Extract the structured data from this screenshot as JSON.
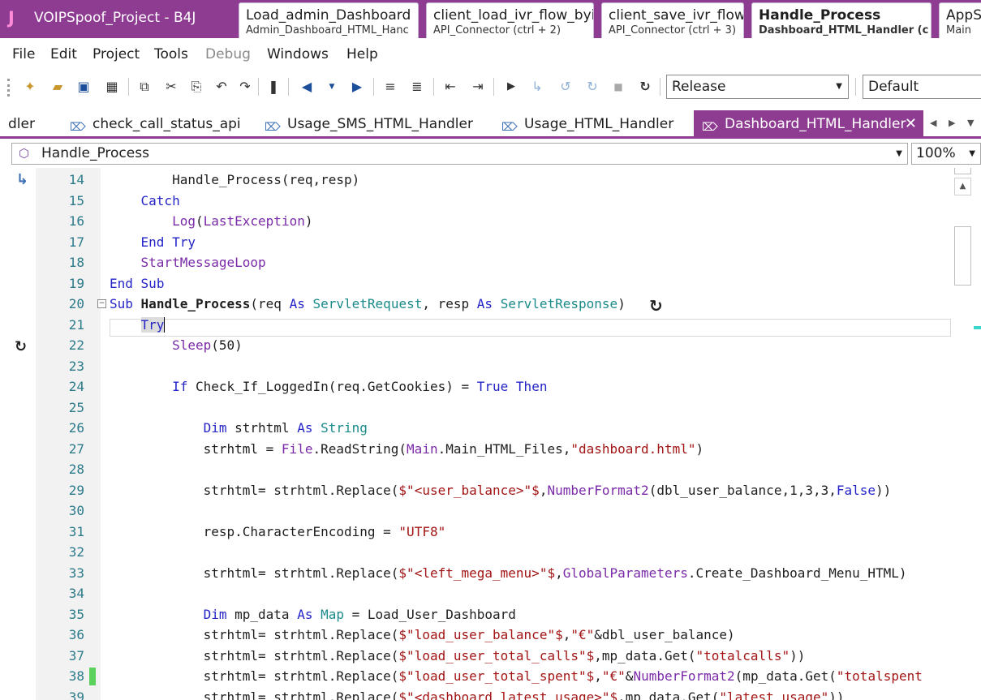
{
  "window": {
    "app_letter": "J",
    "title": "VOIPSpoof_Project - B4J"
  },
  "top_tabs": [
    {
      "title": "Load_admin_Dashboard",
      "sub": "Admin_Dashboard_HTML_Hanc"
    },
    {
      "title": "client_load_ivr_flow_byid",
      "sub": "API_Connector  (ctrl + 2)"
    },
    {
      "title": "client_save_ivr_flow",
      "sub": "API_Connector  (ctrl + 3)"
    },
    {
      "title": "Handle_Process",
      "sub": "Dashboard_HTML_Handler  (c"
    },
    {
      "title": "AppS",
      "sub": "Main"
    }
  ],
  "menu": [
    "File",
    "Edit",
    "Project",
    "Tools",
    "Debug",
    "Windows",
    "Help"
  ],
  "toolbar": {
    "build_config": "Release",
    "platform": "Default"
  },
  "doc_tabs": [
    {
      "label": "dler"
    },
    {
      "label": "check_call_status_api"
    },
    {
      "label": "Usage_SMS_HTML_Handler"
    },
    {
      "label": "Usage_HTML_Handler"
    },
    {
      "label": "Dashboard_HTML_Handler"
    }
  ],
  "nav": {
    "member": "Handle_Process",
    "zoom": "100%"
  },
  "code_lines": [
    {
      "n": "14",
      "text": "        Handle_Process(req,resp)"
    },
    {
      "n": "15",
      "text": "    Catch"
    },
    {
      "n": "16",
      "text": "        Log(LastException)"
    },
    {
      "n": "17",
      "text": "    End Try"
    },
    {
      "n": "18",
      "text": "    StartMessageLoop"
    },
    {
      "n": "19",
      "text": "End Sub"
    },
    {
      "n": "20",
      "text": "Sub Handle_Process(req As ServletRequest, resp As ServletResponse)"
    },
    {
      "n": "21",
      "text": "    Try"
    },
    {
      "n": "22",
      "text": "        Sleep(50)"
    },
    {
      "n": "23",
      "text": ""
    },
    {
      "n": "24",
      "text": "        If Check_If_LoggedIn(req.GetCookies) = True Then"
    },
    {
      "n": "25",
      "text": ""
    },
    {
      "n": "26",
      "text": "            Dim strhtml As String"
    },
    {
      "n": "27",
      "text": "            strhtml = File.ReadString(Main.Main_HTML_Files,\"dashboard.html\")"
    },
    {
      "n": "28",
      "text": ""
    },
    {
      "n": "29",
      "text": "            strhtml= strhtml.Replace($\"<user_balance>\"$,NumberFormat2(dbl_user_balance,1,3,3,False))"
    },
    {
      "n": "30",
      "text": ""
    },
    {
      "n": "31",
      "text": "            resp.CharacterEncoding = \"UTF8\""
    },
    {
      "n": "32",
      "text": ""
    },
    {
      "n": "33",
      "text": "            strhtml= strhtml.Replace($\"<left_mega_menu>\"$,GlobalParameters.Create_Dashboard_Menu_HTML)"
    },
    {
      "n": "34",
      "text": ""
    },
    {
      "n": "35",
      "text": "            Dim mp_data As Map = Load_User_Dashboard"
    },
    {
      "n": "36",
      "text": "            strhtml= strhtml.Replace($\"load_user_balance\"$,\"€\"&dbl_user_balance)"
    },
    {
      "n": "37",
      "text": "            strhtml= strhtml.Replace($\"load_user_total_calls\"$,mp_data.Get(\"totalcalls\"))"
    },
    {
      "n": "38",
      "text": "            strhtml= strhtml.Replace($\"load_user_total_spent\"$,\"€\"&NumberFormat2(mp_data.Get(\"totalspent"
    },
    {
      "n": "39",
      "text": "            strhtml= strhtml.Replace($\"<dashboard_latest_usage>\"$,mp_data.Get(\"latest_usage\"))"
    }
  ],
  "colors": {
    "title_bar": "#8e3b92",
    "keyword": "#2424c8",
    "type": "#1a8a8a",
    "string": "#a31515",
    "function": "#7a2aa8",
    "line_number": "#2b7a8a",
    "change_marker": "#5bd05b"
  }
}
